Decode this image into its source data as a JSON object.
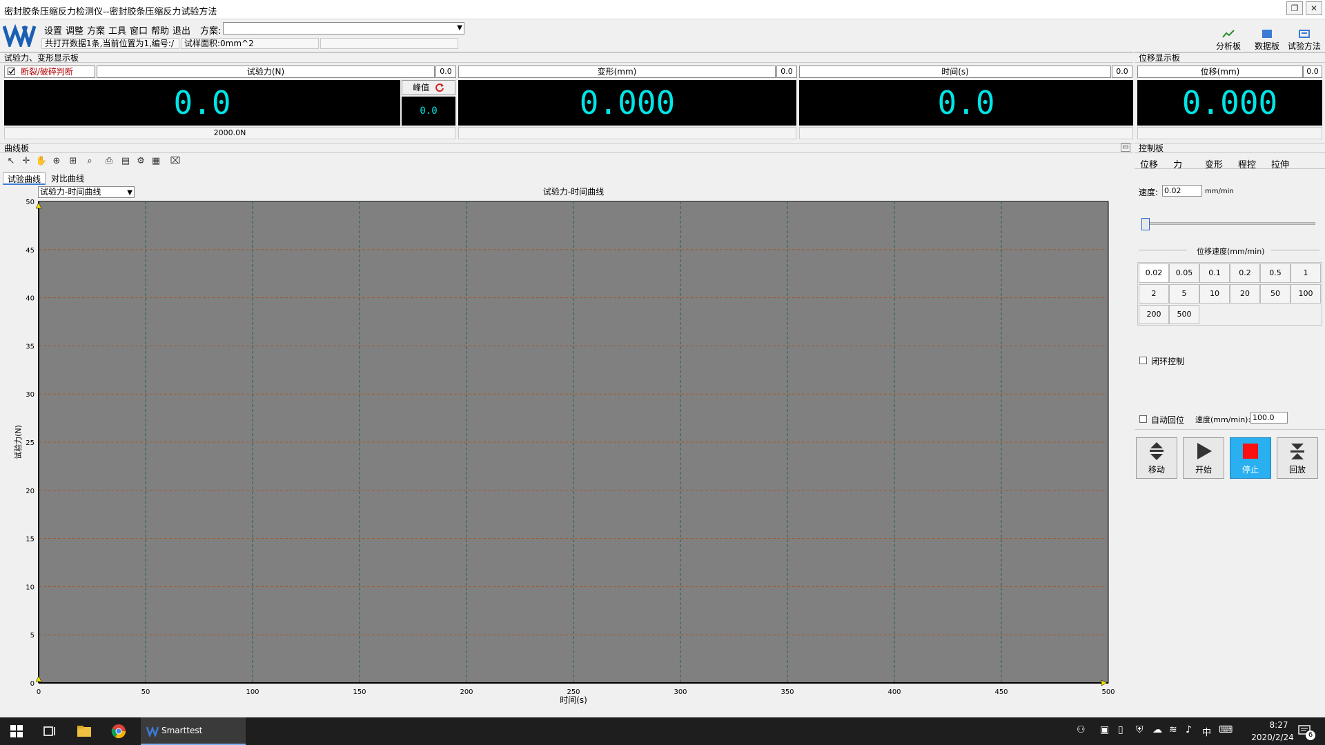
{
  "window": {
    "title": "密封胶条压缩反力检测仪--密封胶条压缩反力试验方法"
  },
  "menus": [
    "设置",
    "调整",
    "方案",
    "工具",
    "窗口",
    "帮助",
    "退出"
  ],
  "scheme": {
    "label": "方案:",
    "value": ""
  },
  "info": {
    "status": "共打开数据1条,当前位置为1,编号:/",
    "area": "试样面积:0mm^2",
    "extra": ""
  },
  "toolbar_buttons": [
    {
      "label": "分析板",
      "icon": "analysis-icon"
    },
    {
      "label": "数据板",
      "icon": "data-icon"
    },
    {
      "label": "试验方法",
      "icon": "method-icon"
    }
  ],
  "display_panel": {
    "title": "试验力、变形显示板",
    "break_check_label": "断裂/破碎判断",
    "force": {
      "header": "试验力(N)",
      "small": "0.0",
      "value": "0.0",
      "bottom": "2000.0N"
    },
    "peak": {
      "label": "峰值",
      "value": "0.0"
    },
    "deform": {
      "header": "变形(mm)",
      "small": "0.0",
      "value": "0.000"
    },
    "time": {
      "header": "时间(s)",
      "small": "0.0",
      "value": "0.0"
    }
  },
  "disp_panel": {
    "title": "位移显示板",
    "header": "位移(mm)",
    "small": "0.0",
    "value": "0.000"
  },
  "curve_panel": {
    "title": "曲线板",
    "tabs": [
      "试验曲线",
      "对比曲线"
    ],
    "select": "试验力-时间曲线"
  },
  "chart_data": {
    "type": "line",
    "title": "试验力-时间曲线",
    "xlabel": "时间(s)",
    "ylabel": "试验力(N)",
    "xlim": [
      0,
      500
    ],
    "ylim": [
      0,
      50
    ],
    "x_ticks": [
      0,
      50,
      100,
      150,
      200,
      250,
      300,
      350,
      400,
      450,
      500
    ],
    "y_ticks": [
      0,
      5,
      10,
      15,
      20,
      25,
      30,
      35,
      40,
      45,
      50
    ],
    "grid": true,
    "series": []
  },
  "control_panel": {
    "title": "控制板",
    "tabs": [
      "位移",
      "力",
      "变形",
      "程控",
      "拉伸"
    ],
    "speed_label": "速度:",
    "speed_value": "0.02",
    "speed_unit": "mm/min",
    "speed_section": "位移速度(mm/min)",
    "speeds": [
      "0.02",
      "0.05",
      "0.1",
      "0.2",
      "0.5",
      "1",
      "2",
      "5",
      "10",
      "20",
      "50",
      "100",
      "200",
      "500"
    ],
    "closed_loop_label": "闭环控制",
    "auto_return_label": "自动回位",
    "return_speed_label": "速度(mm/min):",
    "return_speed_value": "100.0",
    "actions": [
      {
        "label": "移动",
        "icon": "move-icon"
      },
      {
        "label": "开始",
        "icon": "play-icon"
      },
      {
        "label": "停止",
        "icon": "stop-icon"
      },
      {
        "label": "回放",
        "icon": "return-icon"
      }
    ]
  },
  "taskbar": {
    "app": "Smarttest",
    "time": "8:27",
    "date": "2020/2/24",
    "ime": "中",
    "notifications": "6"
  }
}
